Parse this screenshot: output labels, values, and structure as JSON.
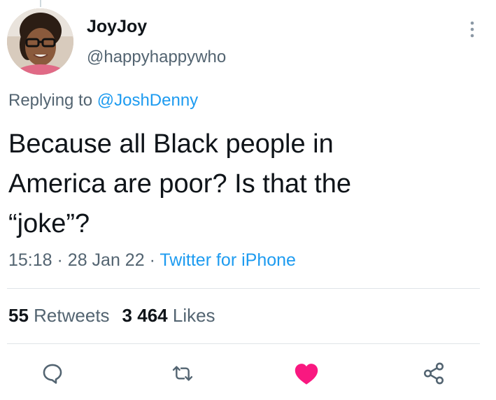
{
  "tweet": {
    "display_name": "JoyJoy",
    "handle": "@happyhappywho",
    "replying_prefix": "Replying to",
    "replying_to": "@JoshDenny",
    "text": "Because all Black people in\nAmerica are poor? Is that the\n“joke”?",
    "time": "15:18",
    "date": "28 Jan 22",
    "separator": "·",
    "source": "Twitter for iPhone"
  },
  "stats": {
    "retweets_count": "55",
    "retweets_label": "Retweets",
    "likes_count": "3 464",
    "likes_label": "Likes"
  },
  "actions": {
    "reply_icon": "reply-icon",
    "retweet_icon": "retweet-icon",
    "like_icon": "heart-icon-filled",
    "share_icon": "share-icon",
    "liked": true
  },
  "colors": {
    "accent": "#1d9bf0",
    "like": "#f91880",
    "secondary_text": "#536471",
    "primary_text": "#0f1419"
  }
}
